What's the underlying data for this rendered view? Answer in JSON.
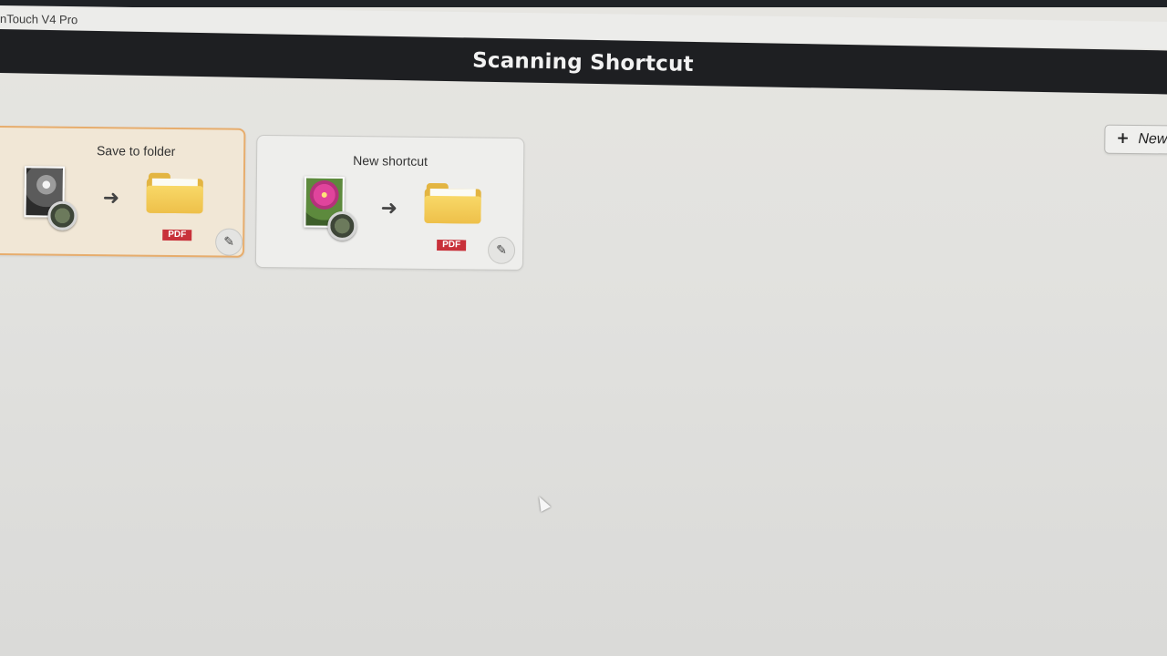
{
  "window": {
    "app_title": "nTouch V4 Pro"
  },
  "header": {
    "title": "Scanning Shortcut"
  },
  "toolbar": {
    "new_label": "New",
    "new_icon": "plus-icon"
  },
  "shortcuts": [
    {
      "title": "Save to folder",
      "source_icon": "grayscale-photo-scan-icon",
      "destination_icon": "folder-icon",
      "format": "PDF",
      "selected": true
    },
    {
      "title": "New shortcut",
      "source_icon": "color-photo-scan-icon",
      "destination_icon": "folder-icon",
      "format": "PDF",
      "selected": false
    }
  ],
  "colors": {
    "header_bg": "#1e1f22",
    "selected_border": "#e7ad6d",
    "selected_bg": "#f1e7d6",
    "pdf_badge": "#c8313a",
    "folder": "#eec04a"
  }
}
